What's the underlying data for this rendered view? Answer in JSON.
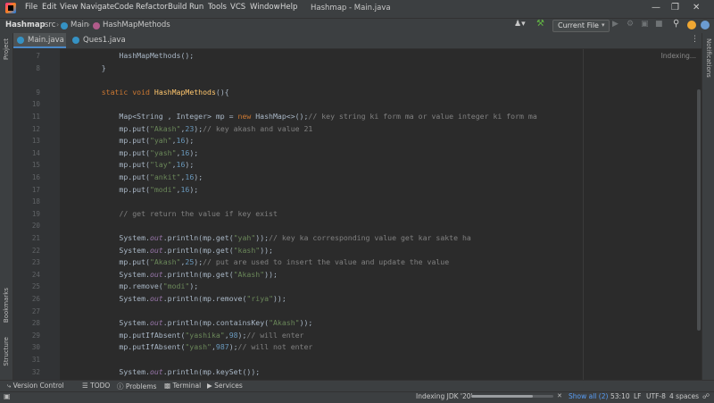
{
  "menu": [
    "File",
    "Edit",
    "View",
    "Navigate",
    "Code",
    "Refactor",
    "Build",
    "Run",
    "Tools",
    "VCS",
    "Window",
    "Help"
  ],
  "window_title": "Hashmap - Main.java",
  "breadcrumb": [
    "Hashmap",
    "src",
    "Main",
    "HashMapMethods"
  ],
  "run_config": "Current File",
  "tabs": [
    {
      "label": "Main.java",
      "active": true
    },
    {
      "label": "Ques1.java",
      "active": false
    }
  ],
  "left_tools": [
    "Project",
    "Bookmarks",
    "Structure"
  ],
  "right_tools": [
    "Notifications"
  ],
  "indexing_label": "Indexing...",
  "code": [
    {
      "n": "7",
      "t": "        HashMapMethods();"
    },
    {
      "n": "8",
      "t": "    }"
    },
    {
      "n": "",
      "t": ""
    },
    {
      "n": "9",
      "t": "    static void HashMapMethods(){"
    },
    {
      "n": "10",
      "t": ""
    },
    {
      "n": "11",
      "t": "        Map<String , Integer> mp = new HashMap<>();// key string ki form ma or value integer ki form ma"
    },
    {
      "n": "12",
      "t": "        mp.put(\"Akash\",23);// key akash and value 21"
    },
    {
      "n": "13",
      "t": "        mp.put(\"yah\",16);"
    },
    {
      "n": "14",
      "t": "        mp.put(\"yash\",16);"
    },
    {
      "n": "15",
      "t": "        mp.put(\"lay\",16);"
    },
    {
      "n": "16",
      "t": "        mp.put(\"ankit\",16);"
    },
    {
      "n": "17",
      "t": "        mp.put(\"modi\",16);"
    },
    {
      "n": "18",
      "t": ""
    },
    {
      "n": "19",
      "t": "        // get return the value if key exist"
    },
    {
      "n": "20",
      "t": ""
    },
    {
      "n": "21",
      "t": "        System.out.println(mp.get(\"yah\"));// key ka corresponding value get kar sakte ha"
    },
    {
      "n": "22",
      "t": "        System.out.println(mp.get(\"kash\"));"
    },
    {
      "n": "23",
      "t": "        mp.put(\"Akash\",25);// put are used to insert the value and update the value"
    },
    {
      "n": "24",
      "t": "        System.out.println(mp.get(\"Akash\"));"
    },
    {
      "n": "25",
      "t": "        mp.remove(\"modi\");"
    },
    {
      "n": "26",
      "t": "        System.out.println(mp.remove(\"riya\"));"
    },
    {
      "n": "27",
      "t": ""
    },
    {
      "n": "28",
      "t": "        System.out.println(mp.containsKey(\"Akash\"));"
    },
    {
      "n": "29",
      "t": "        mp.putIfAbsent(\"yashika\",98);// will enter"
    },
    {
      "n": "30",
      "t": "        mp.putIfAbsent(\"yash\",987);// will not enter"
    },
    {
      "n": "31",
      "t": ""
    },
    {
      "n": "32",
      "t": "        System.out.println(mp.keySet());"
    }
  ],
  "bottom_tools": [
    "Version Control",
    "TODO",
    "Problems",
    "Terminal",
    "Services"
  ],
  "status": {
    "indexing": "Indexing JDK '20'",
    "show_all": "Show all (2)",
    "position": "53:10",
    "line_sep": "LF",
    "encoding": "UTF-8",
    "indent": "4 spaces"
  },
  "progress": 0.75,
  "colors": {
    "accent": "#4a88c7",
    "keyword": "#cc7832",
    "string": "#6a8759",
    "number": "#6897bb",
    "comment": "#808080"
  }
}
